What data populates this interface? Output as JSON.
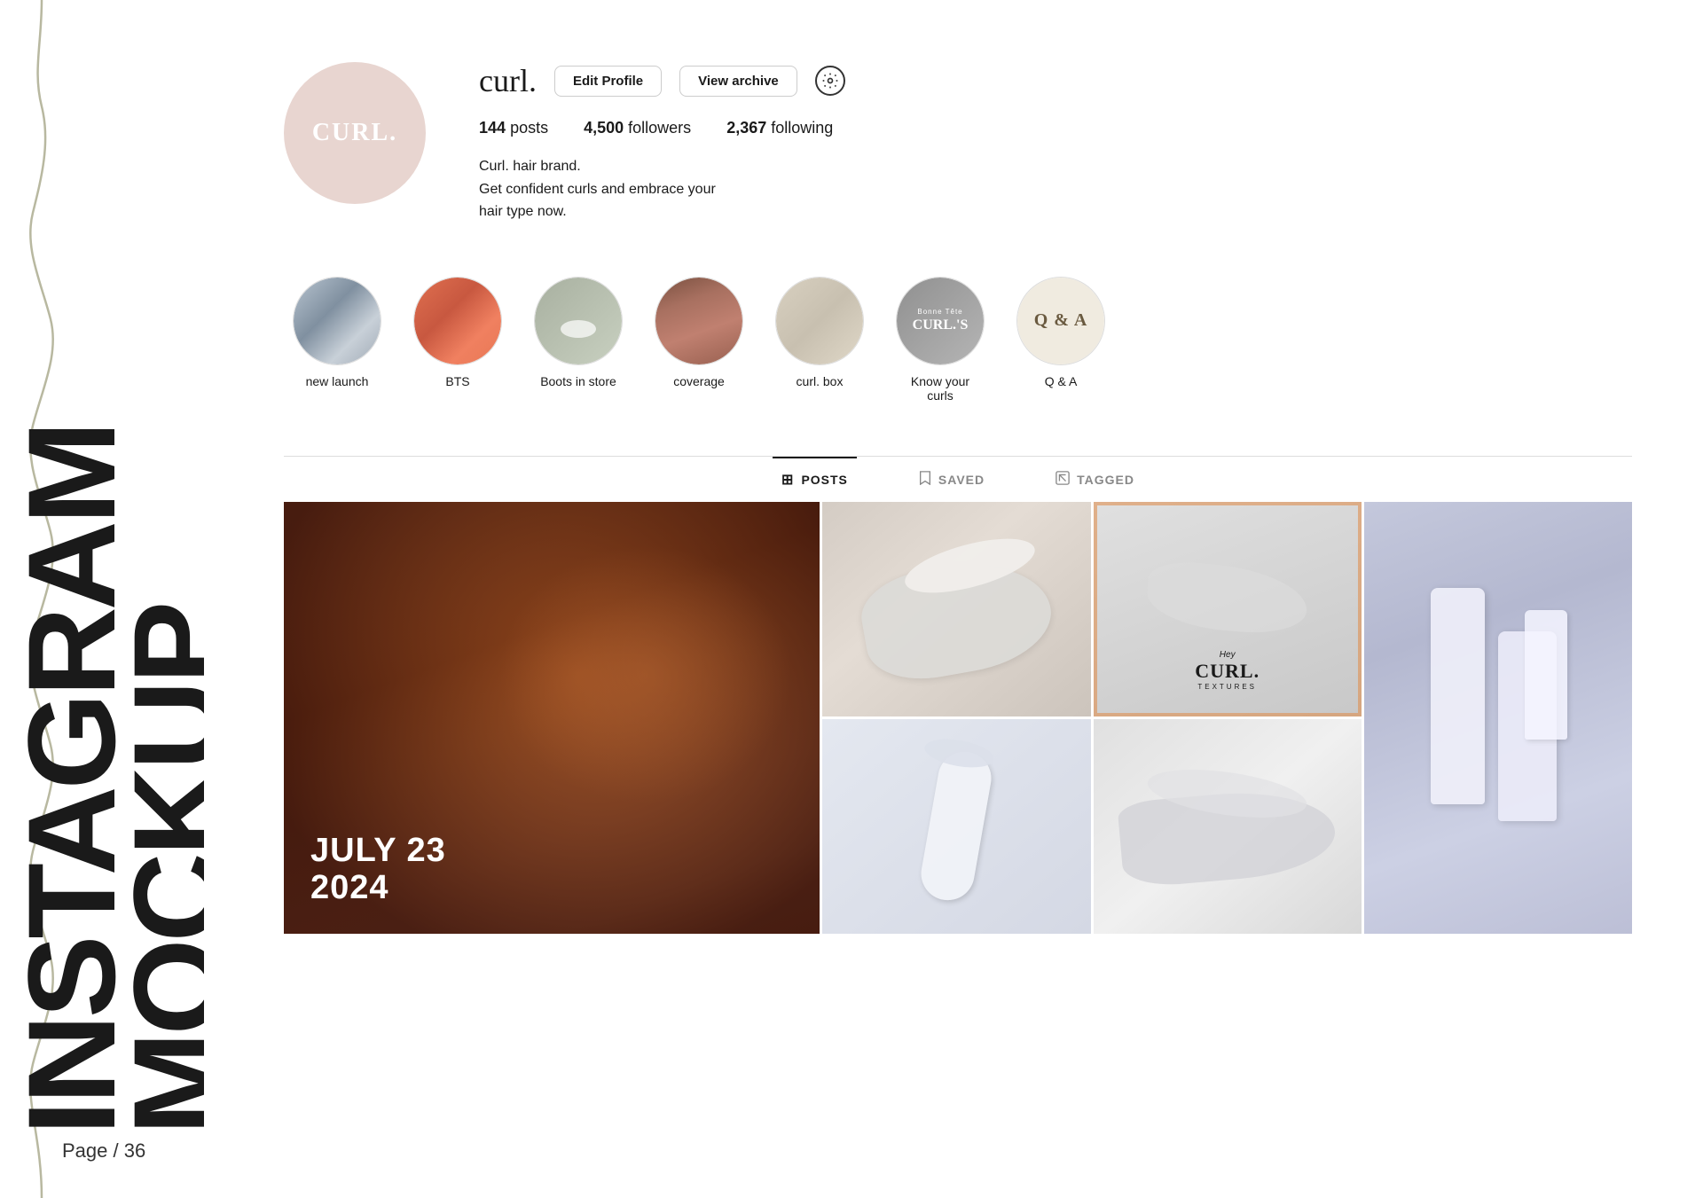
{
  "page": {
    "title": "INSTAGRAM MOCKUP",
    "page_number": "Page / 36"
  },
  "profile": {
    "username": "curl.",
    "avatar_text": "CURL.",
    "edit_btn": "Edit Profile",
    "archive_btn": "View archive",
    "stats": {
      "posts_count": "144",
      "posts_label": "posts",
      "followers_count": "4,500",
      "followers_label": "followers",
      "following_count": "2,367",
      "following_label": "following"
    },
    "bio_line1": "Curl. hair brand.",
    "bio_line2": "Get confident curls and embrace your",
    "bio_line3": "hair type now."
  },
  "highlights": [
    {
      "id": "hl1",
      "label": "new launch",
      "style": "hl-1"
    },
    {
      "id": "hl2",
      "label": "BTS",
      "style": "hl-2"
    },
    {
      "id": "hl3",
      "label": "Boots in store",
      "style": "hl-3"
    },
    {
      "id": "hl4",
      "label": "coverage",
      "style": "hl-4"
    },
    {
      "id": "hl5",
      "label": "curl. box",
      "style": "hl-5"
    },
    {
      "id": "hl6",
      "label": "Know your curls",
      "style": "hl-6"
    },
    {
      "id": "hl7",
      "label": "Q & A",
      "style": "hl-7"
    }
  ],
  "tabs": [
    {
      "id": "posts",
      "label": "POSTS",
      "icon": "grid",
      "active": true
    },
    {
      "id": "saved",
      "label": "SAVED",
      "icon": "bookmark",
      "active": false
    },
    {
      "id": "tagged",
      "label": "TAGGED",
      "icon": "tag",
      "active": false
    }
  ],
  "posts": {
    "grid_posts": [
      {
        "id": "post1",
        "type": "curly-hair",
        "date_text": "JULY 23\n2024"
      },
      {
        "id": "post2",
        "type": "gel-smear"
      },
      {
        "id": "post3",
        "type": "hey-curl-textures"
      },
      {
        "id": "post4",
        "type": "tube-product"
      },
      {
        "id": "post5",
        "type": "gel-smear-2"
      },
      {
        "id": "post6",
        "type": "cream-blob"
      },
      {
        "id": "post7",
        "type": "bottles-lavender"
      }
    ]
  },
  "icons": {
    "settings": "○",
    "grid_icon": "⊞",
    "bookmark_icon": "🔖",
    "tag_icon": "⊡"
  }
}
